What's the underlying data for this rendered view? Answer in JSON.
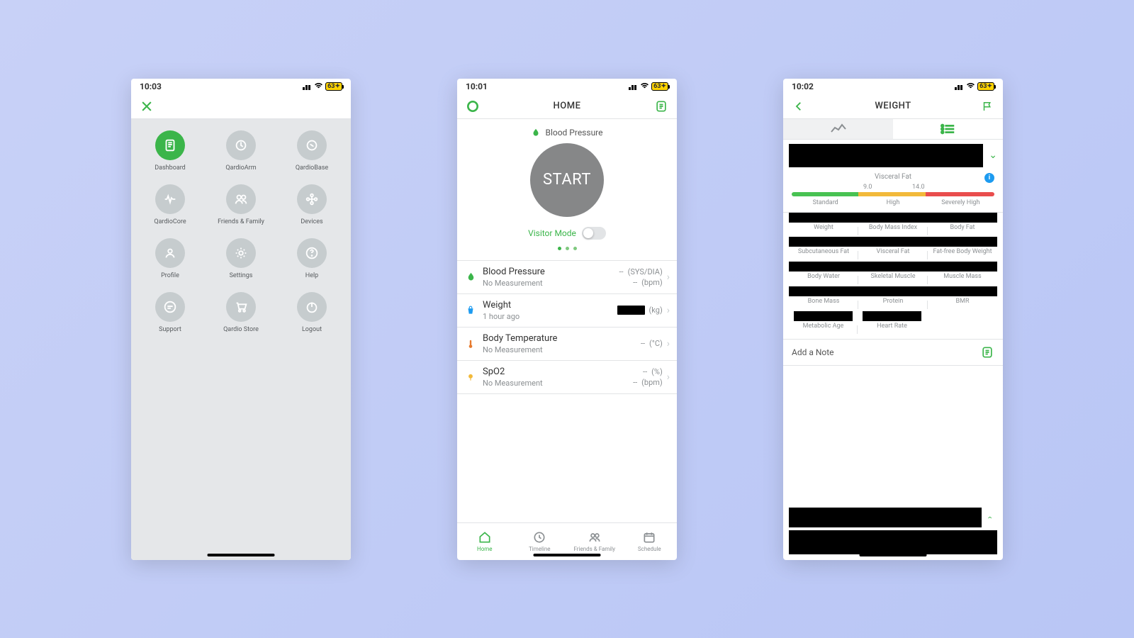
{
  "status": {
    "battery": "63"
  },
  "phone1": {
    "time": "10:03",
    "items": [
      {
        "label": "Dashboard"
      },
      {
        "label": "QardioArm"
      },
      {
        "label": "QardioBase"
      },
      {
        "label": "QardioCore"
      },
      {
        "label": "Friends & Family"
      },
      {
        "label": "Devices"
      },
      {
        "label": "Profile"
      },
      {
        "label": "Settings"
      },
      {
        "label": "Help"
      },
      {
        "label": "Support"
      },
      {
        "label": "Qardio Store"
      },
      {
        "label": "Logout"
      }
    ]
  },
  "phone2": {
    "time": "10:01",
    "title": "HOME",
    "hero_label": "Blood Pressure",
    "start": "START",
    "visitor": "Visitor Mode",
    "metrics": [
      {
        "name": "Blood Pressure",
        "sub": "No Measurement",
        "v1": "--",
        "u1": "(SYS/DIA)",
        "v2": "--",
        "u2": "(bpm)"
      },
      {
        "name": "Weight",
        "sub": "1 hour ago",
        "v1": "",
        "u1": "(kg)",
        "redacted": true
      },
      {
        "name": "Body Temperature",
        "sub": "No Measurement",
        "v1": "--",
        "u1": "(°C)"
      },
      {
        "name": "SpO2",
        "sub": "No Measurement",
        "v1": "--",
        "u1": "(%)",
        "v2": "--",
        "u2": "(bpm)"
      }
    ],
    "tabs": [
      {
        "label": "Home"
      },
      {
        "label": "Timeline"
      },
      {
        "label": "Friends & Family"
      },
      {
        "label": "Schedule"
      }
    ]
  },
  "phone3": {
    "time": "10:02",
    "title": "WEIGHT",
    "vf": {
      "title": "Visceral Fat",
      "tick1": "9.0",
      "tick2": "14.0",
      "lab1": "Standard",
      "lab2": "High",
      "lab3": "Severely High"
    },
    "row1": [
      "Weight",
      "Body Mass Index",
      "Body Fat"
    ],
    "row2": [
      "Subcutaneous Fat",
      "Visceral Fat",
      "Fat-free Body Weight"
    ],
    "row3": [
      "Body Water",
      "Skeletal Muscle",
      "Muscle Mass"
    ],
    "row4": [
      "Bone Mass",
      "Protein",
      "BMR"
    ],
    "row5": [
      "Metabolic Age",
      "Heart Rate"
    ],
    "addnote": "Add a Note"
  }
}
